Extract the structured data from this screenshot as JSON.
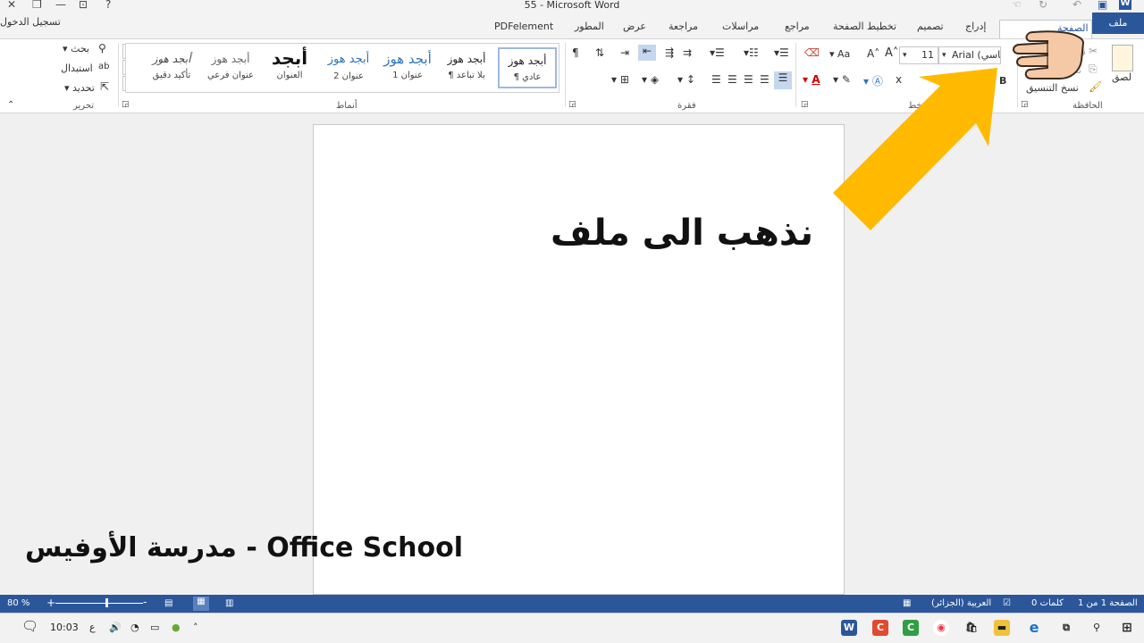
{
  "window": {
    "title": "55 - Microsoft Word",
    "signin": "تسجيل الدخول"
  },
  "tabs": {
    "file": "ملف",
    "home": "الصفحة",
    "insert": "إدراج",
    "design": "تصميم",
    "layout": "تخطيط الصفحة",
    "references": "مراجع",
    "mailings": "مراسلات",
    "review": "مراجعة",
    "view": "عرض",
    "developer": "المطور",
    "pdfelement": "PDFelement"
  },
  "ribbon": {
    "clipboard": {
      "label": "الحافظة",
      "paste": "لصق",
      "cut": "قص",
      "copy": "نسخ",
      "format_painter": "نسخ التنسيق"
    },
    "font": {
      "font_name": "Arial (أساسي)",
      "font_size": "11",
      "grow": "A",
      "shrink": "A",
      "change_case": "Aa",
      "bold": "B",
      "label": "خط"
    },
    "paragraph": {
      "label": "فقرة"
    },
    "styles": {
      "label": "أنماط",
      "items": [
        {
          "preview": "أبجد هوز",
          "name": "¶ عادي"
        },
        {
          "preview": "أبجد هوز",
          "name": "¶ بلا تباعد"
        },
        {
          "preview": "أبجد هوز",
          "name": "عنوان 1"
        },
        {
          "preview": "أبجد هوز",
          "name": "عنوان 2"
        },
        {
          "preview": "أبجد",
          "name": "العنوان"
        },
        {
          "preview": "أبجد هوز",
          "name": "عنوان فرعي"
        },
        {
          "preview": "أبجد هوز",
          "name": "تأكيد دقيق"
        }
      ]
    },
    "editing": {
      "label": "تحرير",
      "find": "بحث",
      "replace": "استبدال",
      "select": "تحديد"
    }
  },
  "overlay": {
    "instruction": "نذهب الى ملف",
    "watermark": "مدرسة الأوفيس - Office School"
  },
  "statusbar": {
    "page": "الصفحة 1 من 1",
    "words": "0 كلمات",
    "language": "العربية (الجزائر)",
    "zoom": "80 %"
  },
  "taskbar": {
    "time": "10:03",
    "lang": "ع"
  },
  "colors": {
    "word_blue": "#2b579a",
    "arrow": "#ffba00"
  }
}
